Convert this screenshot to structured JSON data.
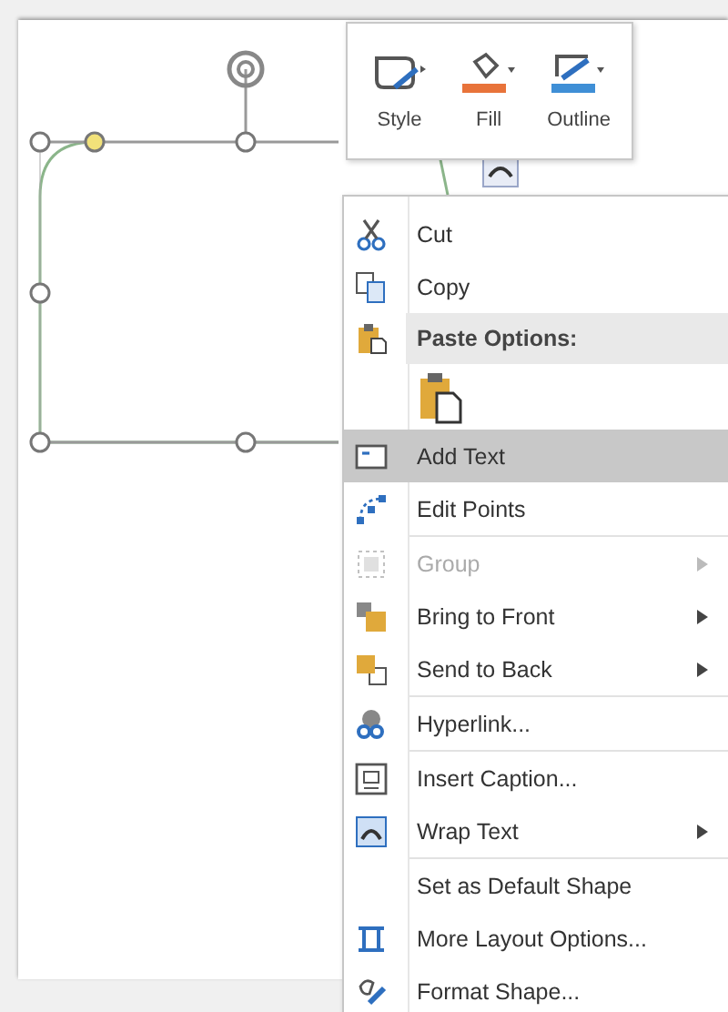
{
  "mini_toolbar": {
    "buttons": [
      {
        "label": "Style"
      },
      {
        "label": "Fill"
      },
      {
        "label": "Outline"
      }
    ]
  },
  "context_menu": {
    "items": [
      {
        "kind": "item",
        "label": "Cut",
        "selected": false,
        "disabled": false,
        "submenu": false
      },
      {
        "kind": "item",
        "label": "Copy",
        "selected": false,
        "disabled": false,
        "submenu": false
      },
      {
        "kind": "header",
        "label": "Paste Options:"
      },
      {
        "kind": "paste"
      },
      {
        "kind": "item",
        "label": "Add Text",
        "selected": true,
        "disabled": false,
        "submenu": false
      },
      {
        "kind": "item",
        "label": "Edit Points",
        "selected": false,
        "disabled": false,
        "submenu": false
      },
      {
        "kind": "separator"
      },
      {
        "kind": "item",
        "label": "Group",
        "selected": false,
        "disabled": true,
        "submenu": true
      },
      {
        "kind": "item",
        "label": "Bring to Front",
        "selected": false,
        "disabled": false,
        "submenu": true
      },
      {
        "kind": "item",
        "label": "Send to Back",
        "selected": false,
        "disabled": false,
        "submenu": true
      },
      {
        "kind": "separator"
      },
      {
        "kind": "item",
        "label": "Hyperlink...",
        "selected": false,
        "disabled": false,
        "submenu": false
      },
      {
        "kind": "separator"
      },
      {
        "kind": "item",
        "label": "Insert Caption...",
        "selected": false,
        "disabled": false,
        "submenu": false
      },
      {
        "kind": "item",
        "label": "Wrap Text",
        "selected": false,
        "disabled": false,
        "submenu": true
      },
      {
        "kind": "separator"
      },
      {
        "kind": "item",
        "label": "Set as Default Shape",
        "selected": false,
        "disabled": false,
        "submenu": false
      },
      {
        "kind": "item",
        "label": "More Layout Options...",
        "selected": false,
        "disabled": false,
        "submenu": false
      },
      {
        "kind": "item",
        "label": "Format Shape...",
        "selected": false,
        "disabled": false,
        "submenu": false
      }
    ]
  }
}
